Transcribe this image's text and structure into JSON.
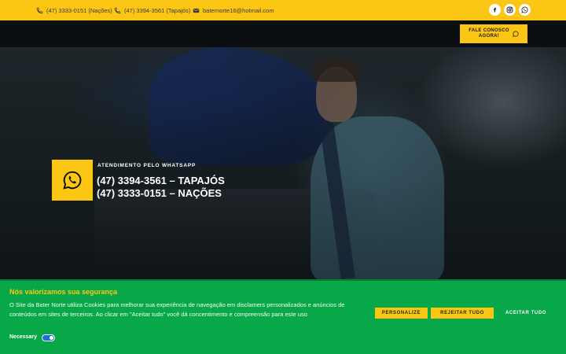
{
  "topbar": {
    "phone_nacoes": "(47) 3333-0151 (Nações)",
    "phone_tapajos": "(47) 3394-3561 (Tapajós)",
    "email": "baternorte16@hotmail.com",
    "social_icons": [
      "facebook-icon",
      "instagram-icon",
      "whatsapp-icon"
    ]
  },
  "header": {
    "cta_label": "FALE CONOSCO AGORA!"
  },
  "hero": {
    "whatsapp_label": "ATENDIMENTO PELO WHATSAPP",
    "phone_1": "(47) 3394-3561 – TAPAJÓS",
    "phone_2": "(47) 3333-0151 – NAÇÕES"
  },
  "cookie": {
    "title": "Nós valorizamos sua segurança",
    "text": "O Site da Bater Norte utiliza Cookies para melhorar sua experiência de navegação em disclamers personalizados e anúncios de conteúdos em sites de terceiros. Ao clicar em \"Aceitar tudo\" você dá concentimento e compreensão para este uso",
    "personalize": "PERSONALIZE",
    "reject": "REJEITAR TUDO",
    "accept": "ACEITAR TUDO",
    "necessary_label": "Necessary"
  },
  "colors": {
    "brand_yellow": "#fcc615",
    "cookie_green": "#08a748",
    "header_dark": "#0c0f11",
    "toggle_blue": "#1e6fd8"
  }
}
